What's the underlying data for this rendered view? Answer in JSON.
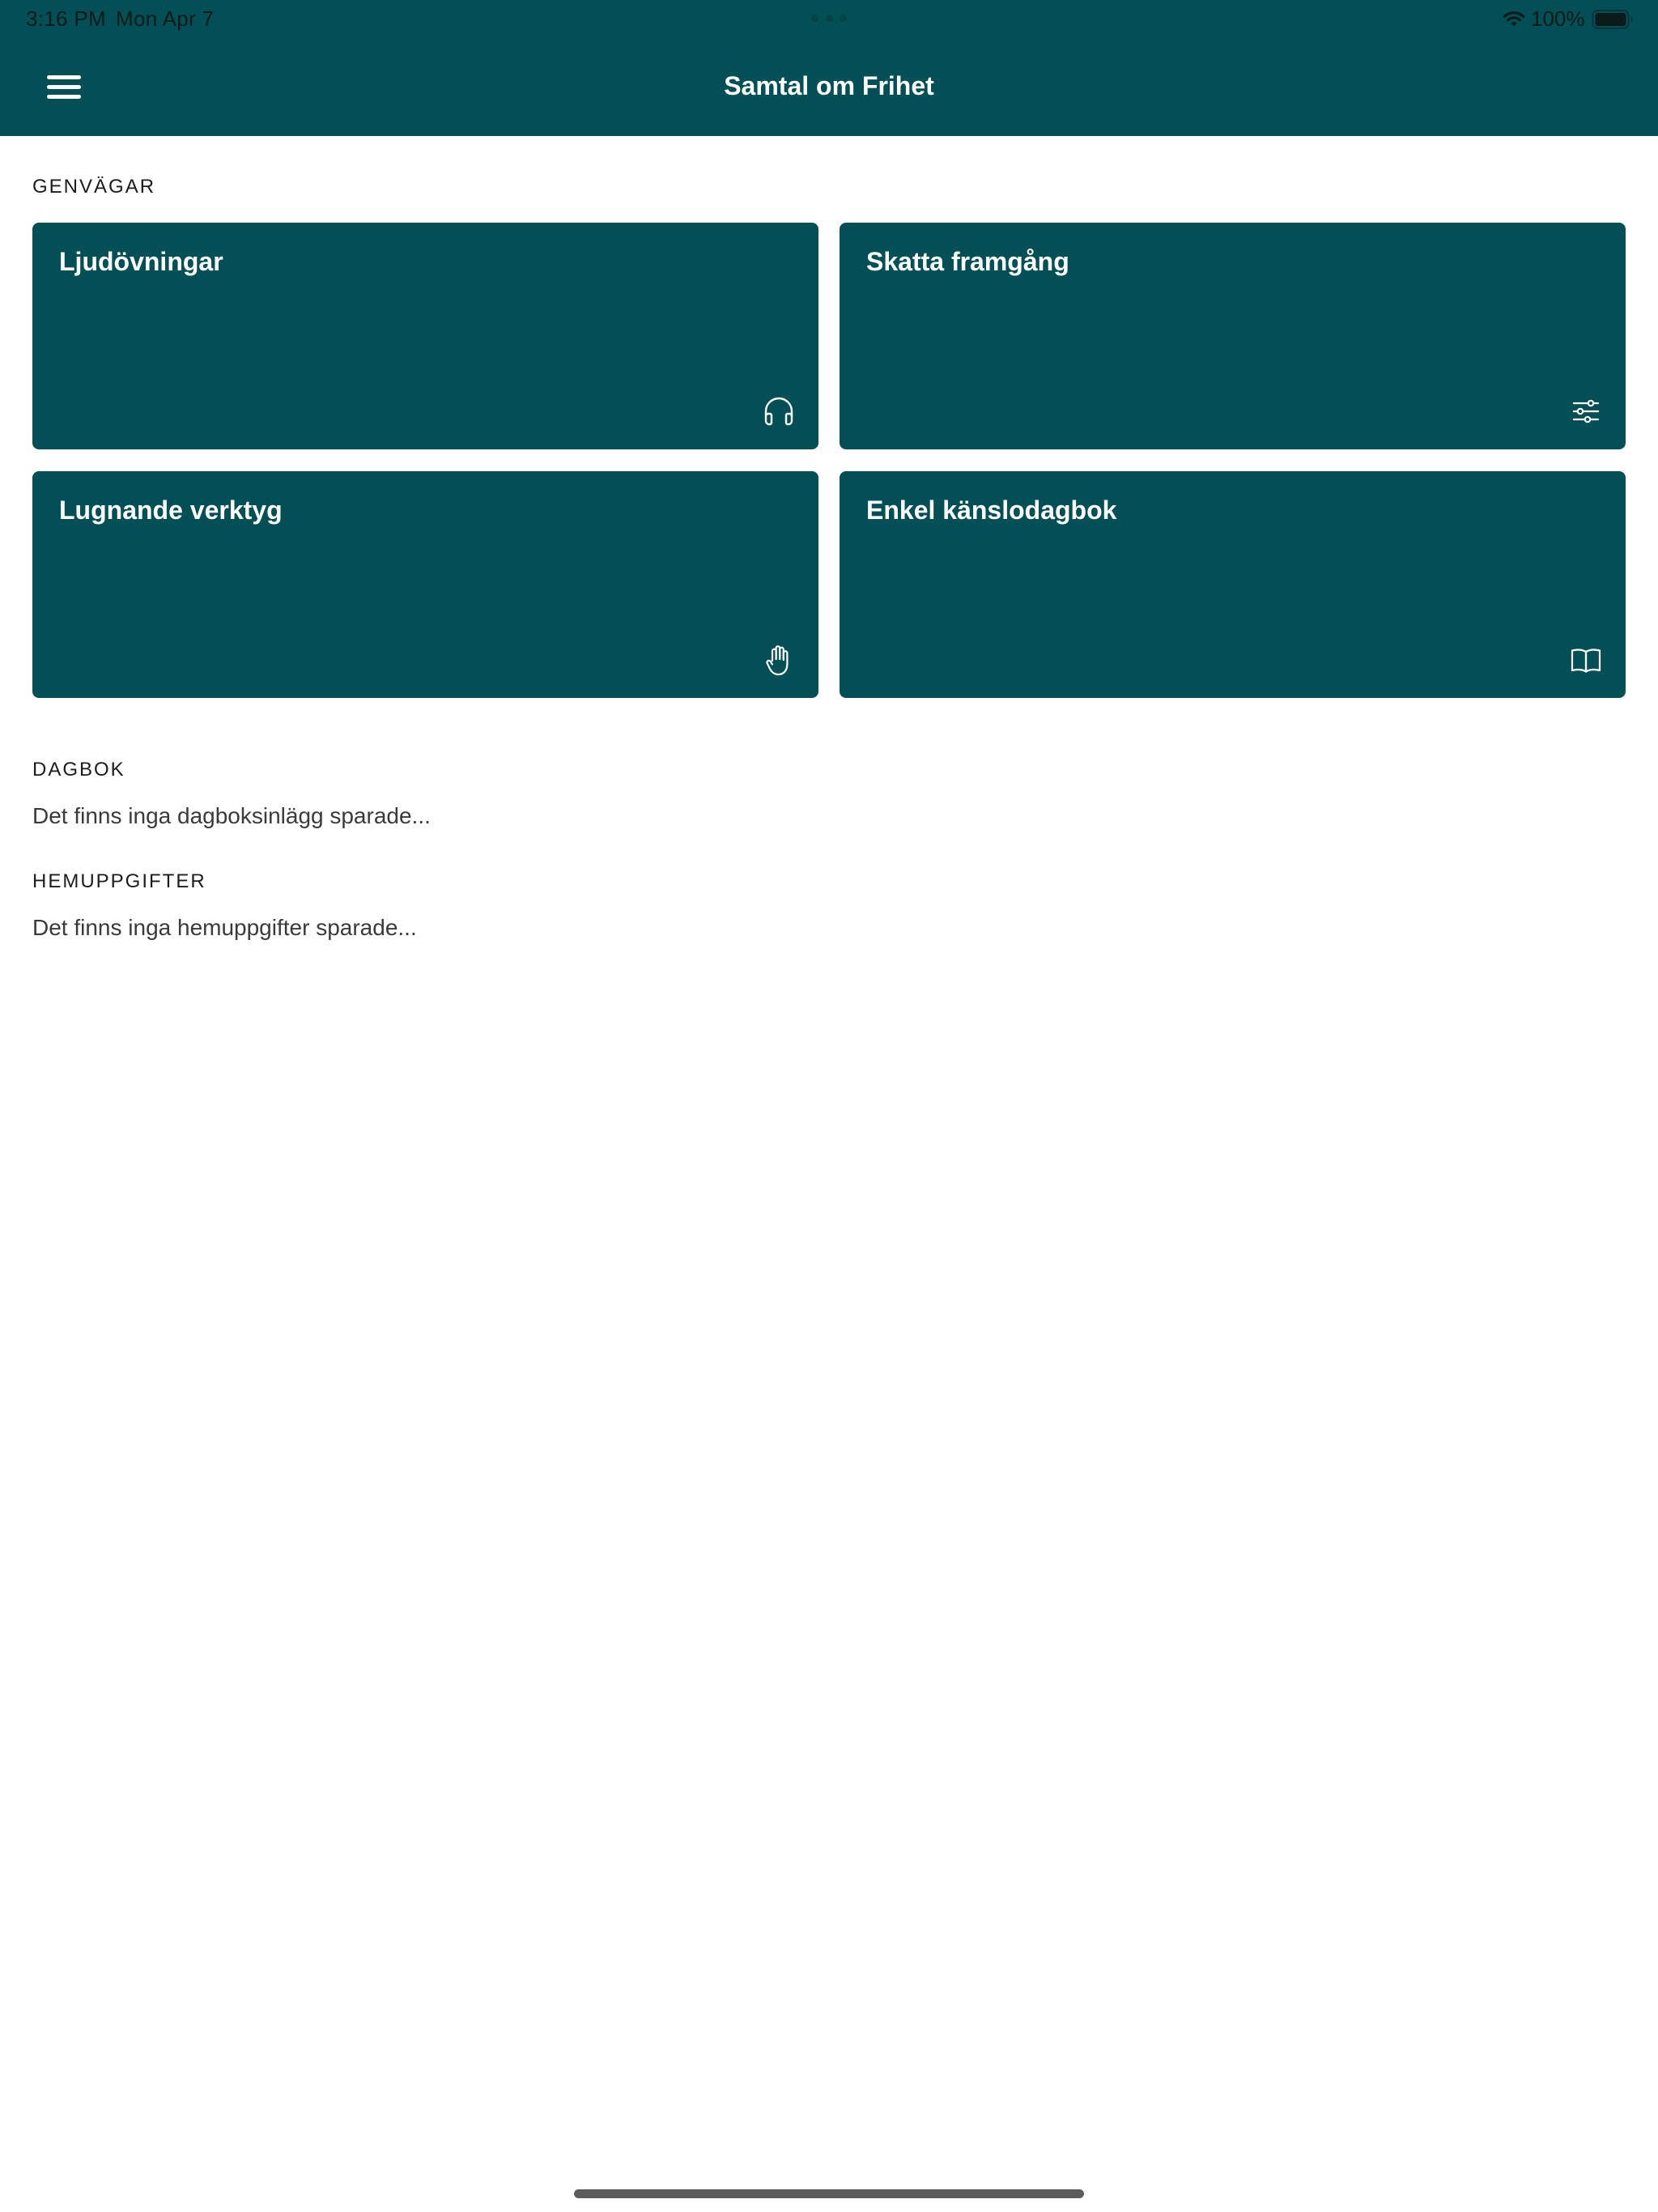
{
  "status_bar": {
    "time": "3:16 PM",
    "date": "Mon Apr 7",
    "battery": "100%"
  },
  "header": {
    "title": "Samtal om Frihet"
  },
  "shortcuts": {
    "label": "GENVÄGAR",
    "cards": [
      {
        "title": "Ljudövningar",
        "icon": "headphones-icon"
      },
      {
        "title": "Skatta framgång",
        "icon": "sliders-icon"
      },
      {
        "title": "Lugnande verktyg",
        "icon": "hand-icon"
      },
      {
        "title": "Enkel känslodagbok",
        "icon": "book-icon"
      }
    ]
  },
  "diary": {
    "label": "DAGBOK",
    "empty_text": "Det finns inga dagboksinlägg sparade..."
  },
  "homework": {
    "label": "HEMUPPGIFTER",
    "empty_text": "Det finns inga hemuppgifter sparade..."
  },
  "colors": {
    "brand": "#024f55",
    "background": "#ffffff",
    "text": "#1c1c1e"
  }
}
